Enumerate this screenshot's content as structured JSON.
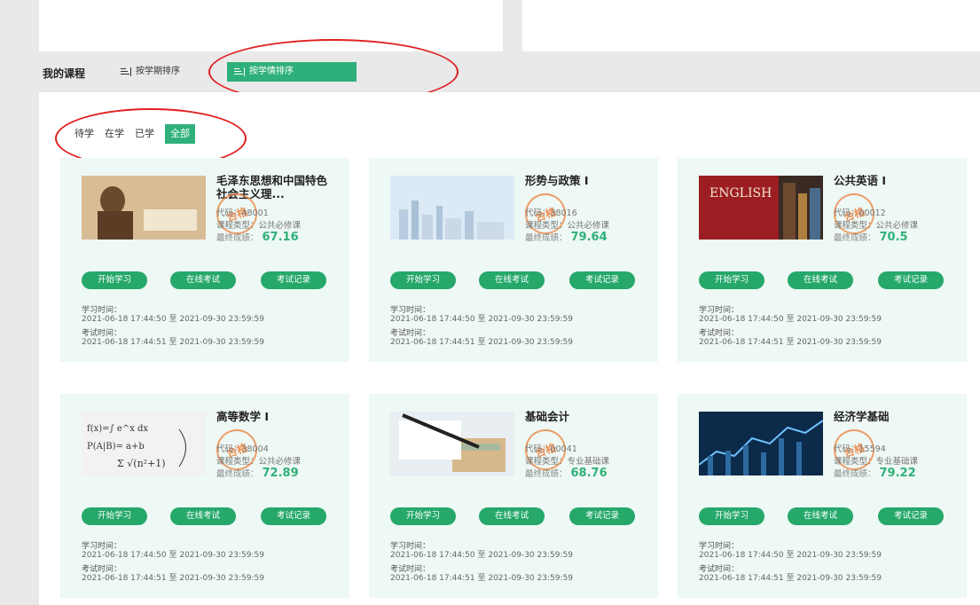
{
  "sort": {
    "title": "我的课程",
    "by_term": "按学期排序",
    "by_status": "按学情排序"
  },
  "filters": [
    "待学",
    "在学",
    "已学",
    "全部"
  ],
  "accent_color": "#2fb07a",
  "labels": {
    "code_prefix": "代码：",
    "type_prefix": "课程类型：",
    "score_prefix": "最终成绩：",
    "stamp": "合格",
    "start": "开始学习",
    "exam": "在线考试",
    "records": "考试记录",
    "study_time": "学习时间：",
    "exam_time": "考试时间：",
    "to": "至"
  },
  "courses": [
    {
      "title": "毛泽东思想和中国特色社会主义理...",
      "code": "48001",
      "type": "公共必修课",
      "score": "67.16",
      "study": [
        "2021-06-18 17:44:50",
        "2021-09-30 23:59:59"
      ],
      "exam": [
        "2021-06-18 17:44:51",
        "2021-09-30 23:59:59"
      ],
      "image": "portrait-photo"
    },
    {
      "title": "形势与政策 I",
      "code": "38016",
      "type": "公共必修课",
      "score": "79.64",
      "study": [
        "2021-06-18 17:44:50",
        "2021-09-30 23:59:59"
      ],
      "exam": [
        "2021-06-18 17:44:51",
        "2021-09-30 23:59:59"
      ],
      "image": "city-skyline"
    },
    {
      "title": "公共英语 I",
      "code": "00012",
      "type": "公共必修课",
      "score": "70.5",
      "study": [
        "2021-06-18 17:44:50",
        "2021-09-30 23:59:59"
      ],
      "exam": [
        "2021-06-18 17:44:51",
        "2021-09-30 23:59:59"
      ],
      "image": "english-books"
    },
    {
      "title": "高等数学 I",
      "code": "38004",
      "type": "公共必修课",
      "score": "72.89",
      "study": [
        "2021-06-18 17:44:50",
        "2021-09-30 23:59:59"
      ],
      "exam": [
        "2021-06-18 17:44:51",
        "2021-09-30 23:59:59"
      ],
      "image": "math-formulas"
    },
    {
      "title": "基础会计",
      "code": "00041",
      "type": "专业基础课",
      "score": "68.76",
      "study": [
        "2021-06-18 17:44:50",
        "2021-09-30 23:59:59"
      ],
      "exam": [
        "2021-06-18 17:44:51",
        "2021-09-30 23:59:59"
      ],
      "image": "pen-calculator"
    },
    {
      "title": "经济学基础",
      "code": "15594",
      "type": "专业基础课",
      "score": "79.22",
      "study": [
        "2021-06-18 17:44:50",
        "2021-09-30 23:59:59"
      ],
      "exam": [
        "2021-06-18 17:44:51",
        "2021-09-30 23:59:59"
      ],
      "image": "finance-chart"
    }
  ]
}
